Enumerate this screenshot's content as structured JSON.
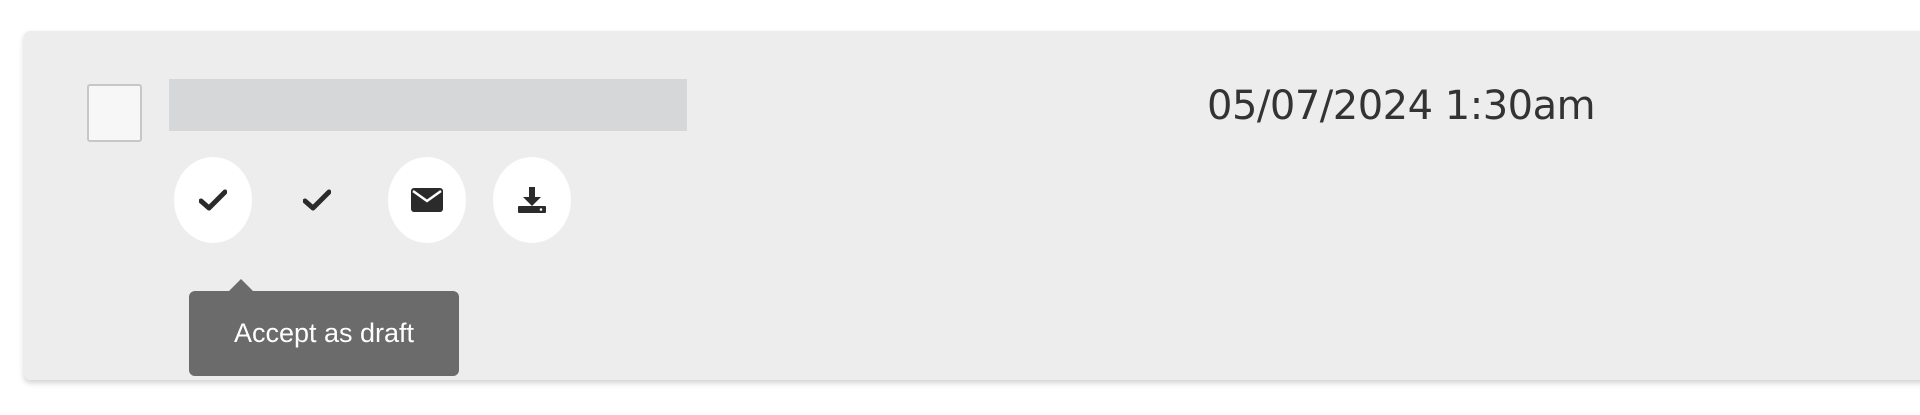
{
  "record": {
    "date": "05/07/2024 1:30am",
    "title": ""
  },
  "actions": [
    {
      "name": "accept-as-draft",
      "icon": "check-icon"
    },
    {
      "name": "accept",
      "icon": "check-icon"
    },
    {
      "name": "email",
      "icon": "envelope-icon"
    },
    {
      "name": "download",
      "icon": "download-icon"
    }
  ],
  "tooltip": {
    "text": "Accept as draft"
  },
  "colors": {
    "card_bg": "#ededed",
    "placeholder_bg": "#d6d7d9",
    "icon_color": "#2b2b2b",
    "tooltip_bg": "#6b6b6b"
  }
}
